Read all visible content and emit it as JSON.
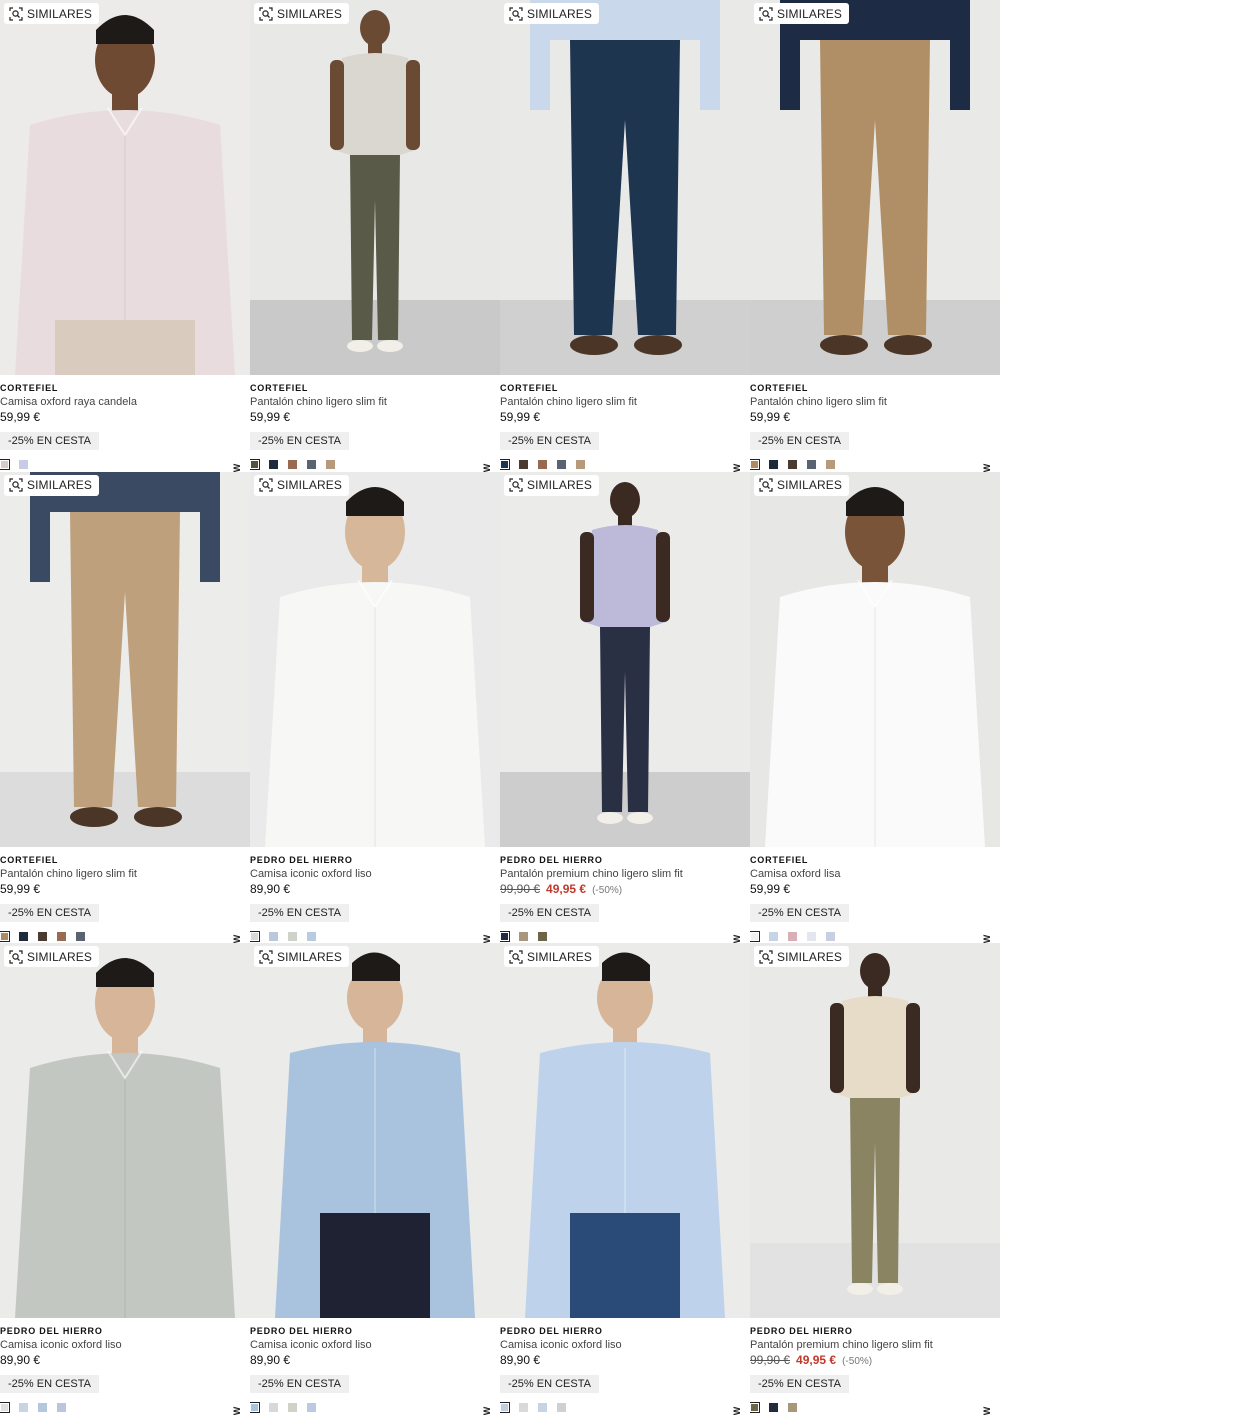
{
  "similar_label": "SIMILARES",
  "new_label": "NEW",
  "products": [
    {
      "brand": "CORTEFIEL",
      "name": "Camisa oxford raya candela",
      "price": "59,99 €",
      "old_price": "",
      "sale_price": "",
      "discount": "",
      "promo": "-25% EN CESTA",
      "swatches": [
        "#d9c9c9",
        "#c8cbe3"
      ],
      "photo": {
        "bg": "#ecebe9",
        "floor": "#ecebe9",
        "garment": "shirt",
        "top": "#e9dcdf",
        "bottom": "#d9cbbd",
        "skin": "#6e4a33"
      }
    },
    {
      "brand": "CORTEFIEL",
      "name": "Pantalón chino ligero slim fit",
      "price": "59,99 €",
      "old_price": "",
      "sale_price": "",
      "discount": "",
      "promo": "-25% EN CESTA",
      "swatches": [
        "#55503f",
        "#1c2a3c",
        "#9a6a50",
        "#5a6470",
        "#b79a7c"
      ],
      "photo": {
        "bg": "#e8e8e7",
        "floor": "#c9c9c9",
        "garment": "full",
        "top": "#d9d7cf",
        "bottom": "#5a5a49",
        "skin": "#6a4a33"
      }
    },
    {
      "brand": "CORTEFIEL",
      "name": "Pantalón chino ligero slim fit",
      "price": "59,99 €",
      "old_price": "",
      "sale_price": "",
      "discount": "",
      "promo": "-25% EN CESTA",
      "swatches": [
        "#1c3350",
        "#4a3a30",
        "#9a6a50",
        "#5a6470",
        "#b79a7c"
      ],
      "photo": {
        "bg": "#e9e9e8",
        "floor": "#d0d0d0",
        "garment": "pants",
        "top": "#c9d8ea",
        "bottom": "#1e3550",
        "skin": "#6a4a33"
      }
    },
    {
      "brand": "CORTEFIEL",
      "name": "Pantalón chino ligero slim fit",
      "price": "59,99 €",
      "old_price": "",
      "sale_price": "",
      "discount": "",
      "promo": "-25% EN CESTA",
      "swatches": [
        "#b08a5e",
        "#1c2a3c",
        "#4a3a30",
        "#5a6470",
        "#b79a7c"
      ],
      "photo": {
        "bg": "#e9e9e8",
        "floor": "#cfcfcf",
        "garment": "pants",
        "top": "#1d2b44",
        "bottom": "#b08e66",
        "skin": "#6a4a33"
      }
    },
    {
      "brand": "CORTEFIEL",
      "name": "Pantalón chino ligero slim fit",
      "price": "59,99 €",
      "old_price": "",
      "sale_price": "",
      "discount": "",
      "promo": "-25% EN CESTA",
      "swatches": [
        "#b08a5e",
        "#1c2a3c",
        "#4a3a30",
        "#9a6a50",
        "#5a6470"
      ],
      "photo": {
        "bg": "#ececeb",
        "floor": "#dcdcdc",
        "garment": "pants",
        "top": "#3b4a63",
        "bottom": "#bfa07c",
        "skin": "#6a4a33"
      }
    },
    {
      "brand": "PEDRO DEL HIERRO",
      "name": "Camisa iconic oxford liso",
      "price": "89,90 €",
      "old_price": "",
      "sale_price": "",
      "discount": "",
      "promo": "-25% EN CESTA",
      "swatches": [
        "#d8d8d8",
        "#b9c9dc",
        "#cfd2c9",
        "#b9cbe0"
      ],
      "photo": {
        "bg": "#eaeaea",
        "floor": "#eaeaea",
        "garment": "shirt",
        "top": "#f7f7f5",
        "bottom": "#f7f7f5",
        "skin": "#d7b79a"
      }
    },
    {
      "brand": "PEDRO DEL HIERRO",
      "name": "Pantalón premium chino ligero slim fit",
      "price": "",
      "old_price": "99,90 €",
      "sale_price": "49,95 €",
      "discount": "(-50%)",
      "promo": "-25% EN CESTA",
      "swatches": [
        "#222a3d",
        "#a8977a",
        "#6b6648"
      ],
      "photo": {
        "bg": "#ebebea",
        "floor": "#cdcdcd",
        "garment": "full",
        "top": "#bcbad8",
        "bottom": "#2a3044",
        "skin": "#3b2a22"
      }
    },
    {
      "brand": "CORTEFIEL",
      "name": "Camisa oxford lisa",
      "price": "59,99 €",
      "old_price": "",
      "sale_price": "",
      "discount": "",
      "promo": "-25% EN CESTA",
      "swatches": [
        "#efefef",
        "#c7d3e6",
        "#d9aeb6",
        "#e3e6ee",
        "#c9cfe3"
      ],
      "photo": {
        "bg": "#e7e7e6",
        "floor": "#e7e7e6",
        "garment": "shirt",
        "top": "#fafafa",
        "bottom": "#fafafa",
        "skin": "#7a5439"
      }
    },
    {
      "brand": "PEDRO DEL HIERRO",
      "name": "Camisa iconic oxford liso",
      "price": "89,90 €",
      "old_price": "",
      "sale_price": "",
      "discount": "",
      "promo": "-25% EN CESTA",
      "swatches": [
        "#e0e0e0",
        "#c9d4e2",
        "#b5c7dc",
        "#b8c6de"
      ],
      "photo": {
        "bg": "#ebebea",
        "floor": "#ebebea",
        "garment": "shirt",
        "top": "#c3c7c2",
        "bottom": "#c3c7c2",
        "skin": "#d6b598"
      }
    },
    {
      "brand": "PEDRO DEL HIERRO",
      "name": "Camisa iconic oxford liso",
      "price": "89,90 €",
      "old_price": "",
      "sale_price": "",
      "discount": "",
      "promo": "-25% EN CESTA",
      "swatches": [
        "#a7c3e0",
        "#d8d8d8",
        "#cfd2c9",
        "#b9cbe0"
      ],
      "photo": {
        "bg": "#ebebea",
        "floor": "#ebebea",
        "garment": "half",
        "top": "#a9c3de",
        "bottom": "#1e2233",
        "skin": "#d6b598"
      }
    },
    {
      "brand": "PEDRO DEL HIERRO",
      "name": "Camisa iconic oxford liso",
      "price": "89,90 €",
      "old_price": "",
      "sale_price": "",
      "discount": "",
      "promo": "-25% EN CESTA",
      "swatches": [
        "#c1cee0",
        "#d9d9d9",
        "#c6d3e2",
        "#cfd0d0"
      ],
      "photo": {
        "bg": "#ebebea",
        "floor": "#ebebea",
        "garment": "half",
        "top": "#bed2ec",
        "bottom": "#2a4a78",
        "skin": "#d6b598"
      }
    },
    {
      "brand": "PEDRO DEL HIERRO",
      "name": "Pantalón premium chino ligero slim fit",
      "price": "",
      "old_price": "99,90 €",
      "sale_price": "49,95 €",
      "discount": "(-50%)",
      "promo": "-25% EN CESTA",
      "swatches": [
        "#6b6648",
        "#222a3d",
        "#a8977a"
      ],
      "photo": {
        "bg": "#e9e9e8",
        "floor": "#e2e2e2",
        "garment": "full",
        "top": "#e6dcc7",
        "bottom": "#8a8463",
        "skin": "#3b2a22"
      }
    }
  ]
}
